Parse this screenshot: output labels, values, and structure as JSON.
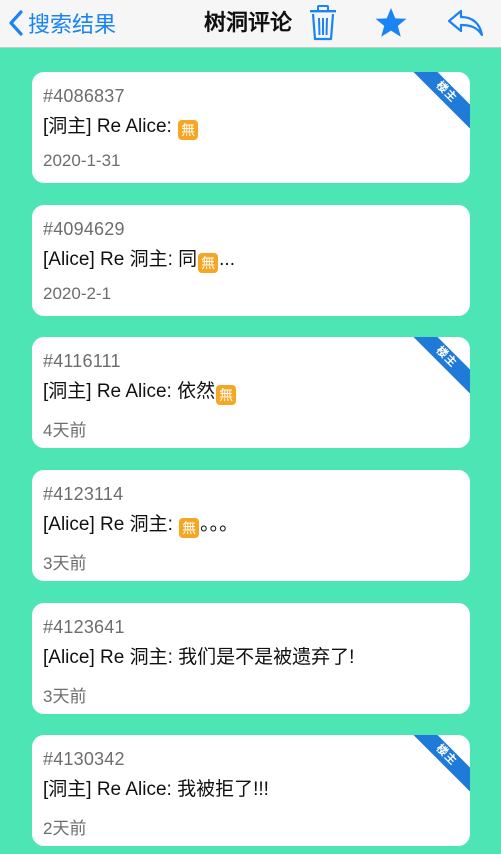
{
  "navbar": {
    "back_label": "搜索结果",
    "title": "树洞评论",
    "icons": [
      "chevron-left-icon",
      "trash-icon",
      "star-icon",
      "reply-icon"
    ],
    "accent": "#1a84f4"
  },
  "background_color": "#4ee5b4",
  "ribbon_color": "#1f7ad8",
  "emoji_color": "#f5a623",
  "owner_ribbon_label": "楼主",
  "comments": [
    {
      "id": "#4086837",
      "text_before": "[洞主] Re Alice: ",
      "emoji": "無",
      "text_after": "",
      "time": "2020-1-31",
      "is_owner": true
    },
    {
      "id": "#4094629",
      "text_before": "[Alice] Re 洞主: 同",
      "emoji": "無",
      "text_after": "...",
      "time": "2020-2-1",
      "is_owner": false
    },
    {
      "id": "#4116111",
      "text_before": "[洞主] Re Alice: 依然",
      "emoji": "無",
      "text_after": "",
      "time": "4天前",
      "is_owner": true
    },
    {
      "id": "#4123114",
      "text_before": "[Alice] Re 洞主: ",
      "emoji": "無",
      "text_after": "。。。",
      "time": "3天前",
      "is_owner": false
    },
    {
      "id": "#4123641",
      "text_before": "[Alice] Re 洞主: 我们是不是被遗弃了!",
      "emoji": "",
      "text_after": "",
      "time": "3天前",
      "is_owner": false
    },
    {
      "id": "#4130342",
      "text_before": "[洞主] Re Alice: 我被拒了!!!",
      "emoji": "",
      "text_after": "",
      "time": "2天前",
      "is_owner": true
    }
  ]
}
